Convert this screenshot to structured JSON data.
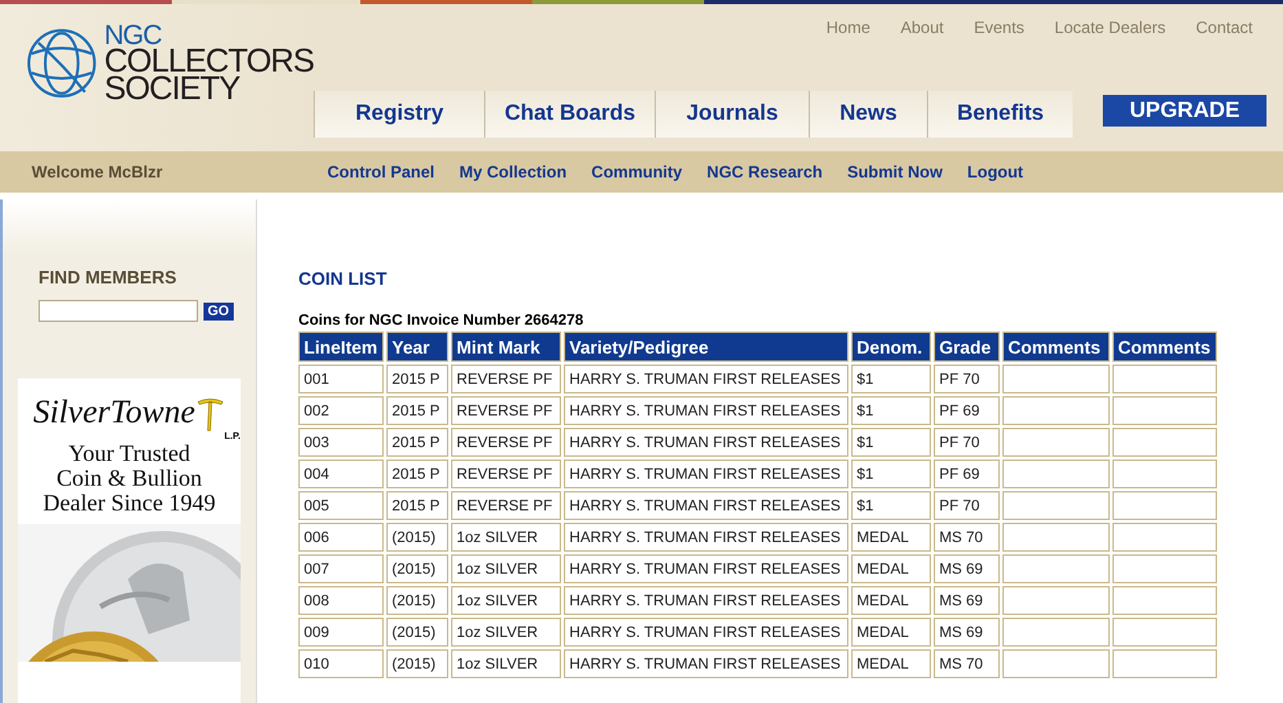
{
  "top_links": [
    "Home",
    "About",
    "Events",
    "Locate Dealers",
    "Contact"
  ],
  "logo": {
    "line1": "NGC",
    "line2": "COLLECTORS",
    "line3": "SOCIETY"
  },
  "tabs": [
    "Registry",
    "Chat Boards",
    "Journals",
    "News",
    "Benefits"
  ],
  "upgrade": "UPGRADE",
  "welcome": "Welcome McBlzr",
  "subnav": [
    "Control Panel",
    "My Collection",
    "Community",
    "NGC Research",
    "Submit Now",
    "Logout"
  ],
  "find_members": {
    "title": "FIND MEMBERS",
    "button": "GO"
  },
  "ad": {
    "brand": "SilverTowne",
    "suffix": "L.P.",
    "tagline": [
      "Your Trusted",
      "Coin & Bullion",
      "Dealer Since 1949"
    ]
  },
  "heading": "COIN LIST",
  "caption": "Coins for NGC Invoice Number 2664278",
  "table": {
    "columns": [
      "LineItem",
      "Year",
      "Mint Mark",
      "Variety/Pedigree",
      "Denom.",
      "Grade",
      "Comments",
      "Comments"
    ],
    "rows": [
      [
        "001",
        "2015 P",
        "REVERSE PF",
        "HARRY S. TRUMAN FIRST RELEASES",
        "$1",
        "PF 70"
      ],
      [
        "002",
        "2015 P",
        "REVERSE PF",
        "HARRY S. TRUMAN FIRST RELEASES",
        "$1",
        "PF 69"
      ],
      [
        "003",
        "2015 P",
        "REVERSE PF",
        "HARRY S. TRUMAN FIRST RELEASES",
        "$1",
        "PF 70"
      ],
      [
        "004",
        "2015 P",
        "REVERSE PF",
        "HARRY S. TRUMAN FIRST RELEASES",
        "$1",
        "PF 69"
      ],
      [
        "005",
        "2015 P",
        "REVERSE PF",
        "HARRY S. TRUMAN FIRST RELEASES",
        "$1",
        "PF 70"
      ],
      [
        "006",
        "(2015)",
        "1oz SILVER",
        "HARRY S. TRUMAN FIRST RELEASES",
        "MEDAL",
        "MS 70"
      ],
      [
        "007",
        "(2015)",
        "1oz SILVER",
        "HARRY S. TRUMAN FIRST RELEASES",
        "MEDAL",
        "MS 69"
      ],
      [
        "008",
        "(2015)",
        "1oz SILVER",
        "HARRY S. TRUMAN FIRST RELEASES",
        "MEDAL",
        "MS 69"
      ],
      [
        "009",
        "(2015)",
        "1oz SILVER",
        "HARRY S. TRUMAN FIRST RELEASES",
        "MEDAL",
        "MS 69"
      ],
      [
        "010",
        "(2015)",
        "1oz SILVER",
        "HARRY S. TRUMAN FIRST RELEASES",
        "MEDAL",
        "MS 70"
      ]
    ]
  }
}
